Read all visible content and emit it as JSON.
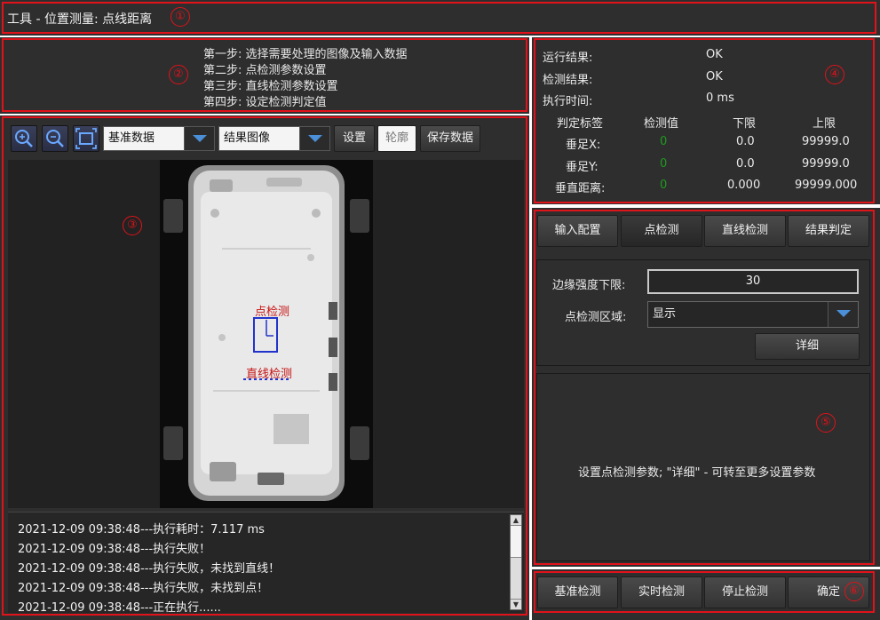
{
  "title": "工具 - 位置测量: 点线距离",
  "markers": [
    "①",
    "②",
    "③",
    "④",
    "⑤",
    "⑥"
  ],
  "steps": [
    "第一步: 选择需要处理的图像及输入数据",
    "第二步: 点检测参数设置",
    "第三步: 直线检测参数设置",
    "第四步: 设定检测判定值"
  ],
  "toolbar": {
    "base_data_select": "基准数据",
    "result_image_select": "结果图像",
    "settings_label": "设置",
    "contour_label": "轮廓",
    "save_label": "保存数据"
  },
  "image": {
    "point_label": "点检测",
    "line_label": "直线检测"
  },
  "log": [
    "2021-12-09 09:38:48---执行耗时：7.117  ms",
    "2021-12-09 09:38:48---执行失败！",
    "2021-12-09 09:38:48---执行失败，未找到直线！",
    "2021-12-09 09:38:48---执行失败，未找到点！",
    "2021-12-09 09:38:48---正在执行......"
  ],
  "results": {
    "run_label": "运行结果:",
    "run_value": "OK",
    "check_label": "检测结果:",
    "check_value": "OK",
    "time_label": "执行时间:",
    "time_value": "0  ms",
    "headers": [
      "判定标签",
      "检测值",
      "下限",
      "上限"
    ],
    "rows": [
      {
        "label": "垂足X:",
        "value": "0",
        "lower": "0.0",
        "upper": "99999.0"
      },
      {
        "label": "垂足Y:",
        "value": "0",
        "lower": "0.0",
        "upper": "99999.0"
      },
      {
        "label": "垂直距离:",
        "value": "0",
        "lower": "0.000",
        "upper": "99999.000"
      }
    ]
  },
  "tabs": [
    "输入配置",
    "点检测",
    "直线检测",
    "结果判定"
  ],
  "params": {
    "edge_label": "边缘强度下限:",
    "edge_value": "30",
    "region_label": "点检测区域:",
    "region_value": "显示",
    "detail_label": "详细"
  },
  "hint": "设置点检测参数; \"详细\" - 可转至更多设置参数",
  "footer": [
    "基准检测",
    "实时检测",
    "停止检测",
    "确定"
  ],
  "colors": {
    "marker": "#e0121a",
    "panel": "#2e2e2e",
    "accent": "#4a8fd8",
    "value_green": "#1f9a1f"
  }
}
